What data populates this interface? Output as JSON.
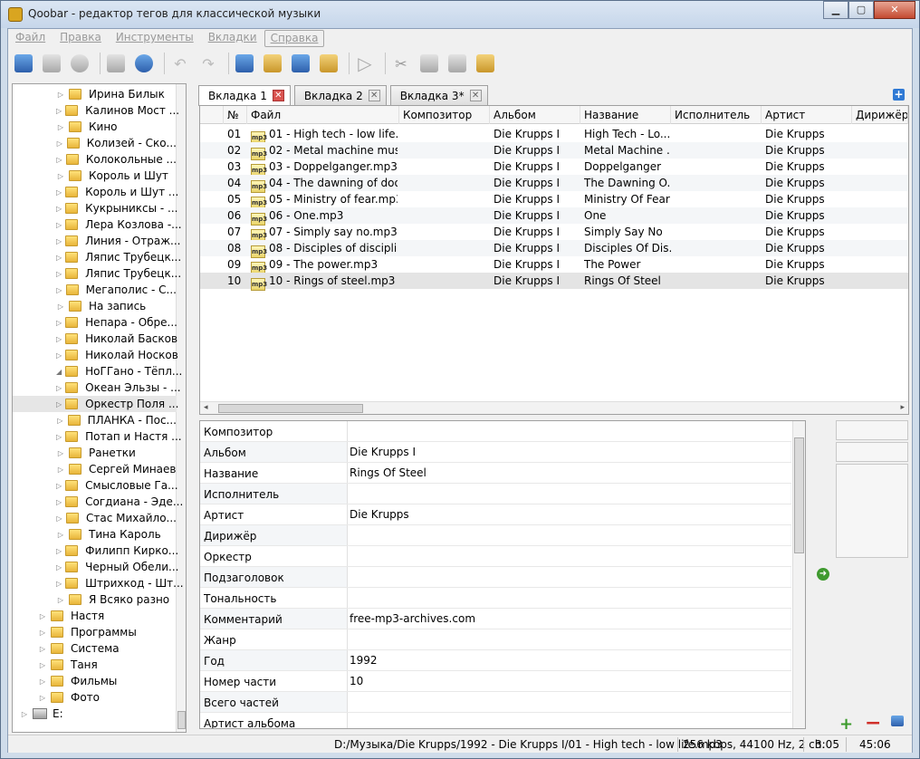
{
  "window": {
    "title": "Qoobar - редактор тегов для классической музыки"
  },
  "menu": [
    "Файл",
    "Правка",
    "Инструменты",
    "Вкладки",
    "Справка"
  ],
  "toolbar_icons": [
    "open-folder-icon",
    "add-file-icon",
    "cd-icon",
    "download-icon",
    "refresh-icon",
    "undo-icon",
    "redo-icon",
    "save-icon",
    "paste-tags-icon",
    "remove-tags-icon",
    "rename-file-icon",
    "play-icon",
    "cut-icon",
    "copy-icon",
    "paste-icon",
    "tag-edit-icon"
  ],
  "tree": {
    "items": [
      {
        "label": "Ирина Билык",
        "level": 2
      },
      {
        "label": "Калинов Мост ...",
        "level": 2
      },
      {
        "label": "Кино",
        "level": 2
      },
      {
        "label": "Колизей - Ско...",
        "level": 2
      },
      {
        "label": "Колокольные ...",
        "level": 2
      },
      {
        "label": "Король и Шут",
        "level": 2
      },
      {
        "label": "Король и Шут ...",
        "level": 2
      },
      {
        "label": "Кукрыниксы - ...",
        "level": 2
      },
      {
        "label": "Лера Козлова -...",
        "level": 2
      },
      {
        "label": "Линия - Отраж...",
        "level": 2
      },
      {
        "label": "Ляпис Трубецк...",
        "level": 2
      },
      {
        "label": "Ляпис Трубецк...",
        "level": 2
      },
      {
        "label": "Мегаполис - С...",
        "level": 2
      },
      {
        "label": "На запись",
        "level": 2
      },
      {
        "label": "Непара - Обре...",
        "level": 2
      },
      {
        "label": "Николай Басков",
        "level": 2
      },
      {
        "label": "Николай Носков",
        "level": 2
      },
      {
        "label": "НоГГано - Тёпл...",
        "level": 2,
        "expanded": true
      },
      {
        "label": "Океан Эльзы - ...",
        "level": 2
      },
      {
        "label": "Оркестр Поля ...",
        "level": 2,
        "selected": true
      },
      {
        "label": "ПЛАНКА - Пос...",
        "level": 2
      },
      {
        "label": "Потап и Настя ...",
        "level": 2
      },
      {
        "label": "Ранетки",
        "level": 2
      },
      {
        "label": "Сергей Минаев",
        "level": 2
      },
      {
        "label": "Смысловые Га...",
        "level": 2
      },
      {
        "label": "Согдиана - Эде...",
        "level": 2
      },
      {
        "label": "Стас Михайло...",
        "level": 2
      },
      {
        "label": "Тина Кароль",
        "level": 2
      },
      {
        "label": "Филипп Кирко...",
        "level": 2
      },
      {
        "label": "Черный Обели...",
        "level": 2
      },
      {
        "label": "Штрихкод - Шт...",
        "level": 2
      },
      {
        "label": "Я Всяко разно",
        "level": 2
      },
      {
        "label": "Настя",
        "level": 1
      },
      {
        "label": "Программы",
        "level": 1
      },
      {
        "label": "Система",
        "level": 1
      },
      {
        "label": "Таня",
        "level": 1
      },
      {
        "label": "Фильмы",
        "level": 1
      },
      {
        "label": "Фото",
        "level": 1
      },
      {
        "label": "E:",
        "level": 0,
        "drive": true
      }
    ]
  },
  "tabs": [
    {
      "label": "Вкладка 1",
      "active": true
    },
    {
      "label": "Вкладка 2",
      "active": false
    },
    {
      "label": "Вкладка 3*",
      "active": false
    }
  ],
  "table": {
    "columns": [
      "№",
      "Файл",
      "Композитор",
      "Альбом",
      "Название",
      "Исполнитель",
      "Артист",
      "Дирижёр"
    ],
    "rows": [
      {
        "num": "01",
        "file": "01 - High tech - low life....",
        "album": "Die Krupps I",
        "title": "High Tech - Lo...",
        "artist": "Die Krupps"
      },
      {
        "num": "02",
        "file": "02 - Metal machine mus...",
        "album": "Die Krupps I",
        "title": "Metal Machine ...",
        "artist": "Die Krupps"
      },
      {
        "num": "03",
        "file": "03 - Doppelganger.mp3",
        "album": "Die Krupps I",
        "title": "Doppelganger",
        "artist": "Die Krupps"
      },
      {
        "num": "04",
        "file": "04 - The dawning of doo...",
        "album": "Die Krupps I",
        "title": "The Dawning O...",
        "artist": "Die Krupps"
      },
      {
        "num": "05",
        "file": "05 - Ministry of fear.mp3",
        "album": "Die Krupps I",
        "title": "Ministry Of Fear",
        "artist": "Die Krupps"
      },
      {
        "num": "06",
        "file": "06 - One.mp3",
        "album": "Die Krupps I",
        "title": "One",
        "artist": "Die Krupps"
      },
      {
        "num": "07",
        "file": "07 - Simply say no.mp3",
        "album": "Die Krupps I",
        "title": "Simply Say No",
        "artist": "Die Krupps"
      },
      {
        "num": "08",
        "file": "08 - Disciples of disciplin...",
        "album": "Die Krupps I",
        "title": "Disciples Of Dis...",
        "artist": "Die Krupps"
      },
      {
        "num": "09",
        "file": "09 - The power.mp3",
        "album": "Die Krupps I",
        "title": "The Power",
        "artist": "Die Krupps"
      },
      {
        "num": "10",
        "file": "10 - Rings of steel.mp3",
        "album": "Die Krupps I",
        "title": "Rings Of Steel",
        "artist": "Die Krupps",
        "selected": true
      }
    ],
    "file_badge": "mp3"
  },
  "tags": [
    {
      "label": "Композитор",
      "value": ""
    },
    {
      "label": "Альбом",
      "value": "Die Krupps I"
    },
    {
      "label": "Название",
      "value": "Rings Of Steel"
    },
    {
      "label": "Исполнитель",
      "value": ""
    },
    {
      "label": "Артист",
      "value": "Die Krupps"
    },
    {
      "label": "Дирижёр",
      "value": ""
    },
    {
      "label": "Оркестр",
      "value": ""
    },
    {
      "label": "Подзаголовок",
      "value": ""
    },
    {
      "label": "Тональность",
      "value": ""
    },
    {
      "label": "Комментарий",
      "value": "free-mp3-archives.com"
    },
    {
      "label": "Жанр",
      "value": ""
    },
    {
      "label": "Год",
      "value": "1992"
    },
    {
      "label": "Номер части",
      "value": "10"
    },
    {
      "label": "Всего частей",
      "value": ""
    },
    {
      "label": "Артист альбома",
      "value": ""
    }
  ],
  "status": {
    "path": "D:/Музыка/Die Krupps/1992 - Die Krupps I/01 - High tech - low life.mp3",
    "info": "256 kbps, 44100 Hz, 2 ch.",
    "duration": "3:05",
    "total": "45:06"
  },
  "colors": {
    "selection": "#e4e4e4",
    "accent": "#2f79d4"
  }
}
